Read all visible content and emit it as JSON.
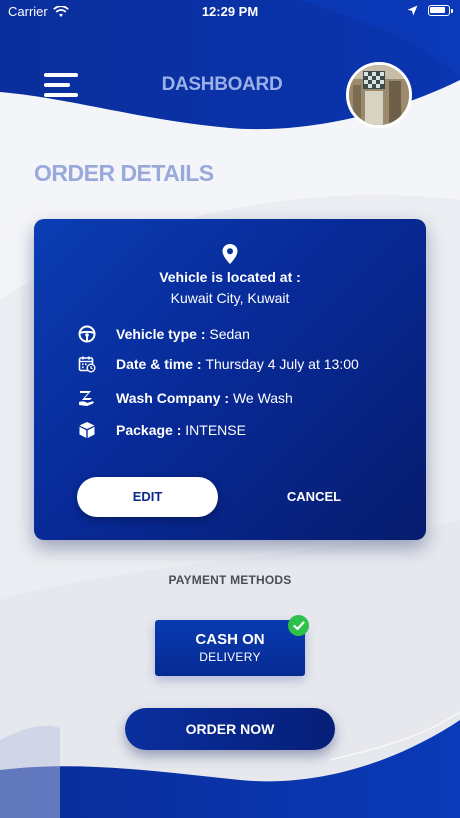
{
  "status_bar": {
    "carrier": "Carrier",
    "time": "12:29 PM",
    "icons": [
      "wifi-icon",
      "location-arrow-icon",
      "battery-icon"
    ]
  },
  "header": {
    "title": "DASHBOARD",
    "menu_icon": "hamburger-menu-icon"
  },
  "section_title": "ORDER DETAILS",
  "order": {
    "location_icon": "map-pin-icon",
    "location_label": "Vehicle is located at :",
    "location_value": "Kuwait City, Kuwait",
    "details": [
      {
        "icon": "steering-wheel-icon",
        "label": "Vehicle type : ",
        "value": "Sedan"
      },
      {
        "icon": "calendar-clock-icon",
        "label": "Date & time : ",
        "value": "Thursday 4 July at 13:00"
      },
      {
        "icon": "wash-company-icon",
        "label": "Wash Company : ",
        "value": "We Wash"
      },
      {
        "icon": "package-box-icon",
        "label": "Package : ",
        "value": "INTENSE"
      }
    ],
    "edit_label": "EDIT",
    "cancel_label": "CANCEL"
  },
  "payment": {
    "title": "PAYMENT METHODS",
    "selected_main": "CASH ON",
    "selected_sub": "DELIVERY",
    "selected_icon": "check-circle-icon"
  },
  "order_now_label": "ORDER NOW",
  "colors": {
    "primary": "#082a98",
    "primary_dark": "#061c6e",
    "accent_light": "#9aa9dc",
    "success": "#2ec14a",
    "background": "#f4f5f8"
  }
}
